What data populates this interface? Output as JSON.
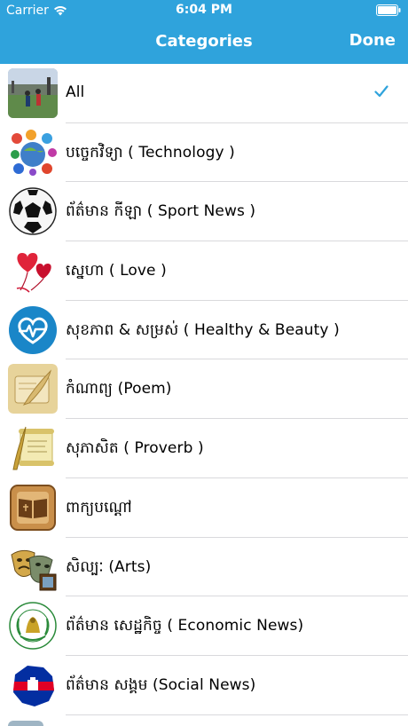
{
  "status_bar": {
    "carrier": "Carrier",
    "time": "6:04 PM"
  },
  "nav": {
    "title": "Categories",
    "done_label": "Done"
  },
  "categories": [
    {
      "label": "All",
      "icon": "sports-field-photo",
      "selected": true
    },
    {
      "label": "បច្ចេកវិទ្យា ( Technology )",
      "icon": "social-media-globe-icon"
    },
    {
      "label": "ព័ត៌មាន កីឡា ( Sport News )",
      "icon": "soccer-ball-icon"
    },
    {
      "label": "ស្នេហា ( Love )",
      "icon": "heart-balloons-icon"
    },
    {
      "label": "សុខភាព & សម្រស់ ( Healthy & Beauty )",
      "icon": "heart-pulse-icon"
    },
    {
      "label": "កំណាព្យ (Poem)",
      "icon": "quill-scroll-icon"
    },
    {
      "label": "សុភាសិត ( Proverb )",
      "icon": "proverb-scroll-icon"
    },
    {
      "label": "ពាក្យបណ្ដៅ",
      "icon": "book-frame-icon"
    },
    {
      "label": "សិល្បៈ (Arts)",
      "icon": "theater-masks-icon"
    },
    {
      "label": "ព័ត៌មាន សេដ្ឋកិច្ច ( Economic News)",
      "icon": "ministry-seal-icon"
    },
    {
      "label": "ព័ត៌មាន សង្គម (Social News)",
      "icon": "cambodia-map-flag-icon"
    }
  ],
  "colors": {
    "header": "#2fa3dc",
    "check": "#2fa3dc",
    "separator": "#d9d9dc"
  }
}
